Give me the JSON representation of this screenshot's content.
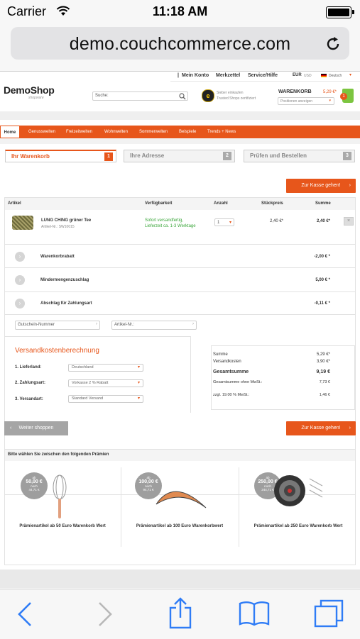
{
  "status_bar": {
    "carrier": "Carrier",
    "time": "11:18 AM"
  },
  "url_bar": {
    "url": "demo.couchcommerce.com"
  },
  "shop": {
    "top_links": [
      "Mein Konto",
      "Merkzettel",
      "Service/Hilfe"
    ],
    "currency": [
      "EUR",
      "USD"
    ],
    "language": "Deutsch",
    "logo_main": "DemoShop",
    "logo_sub": "shopware",
    "search_placeholder": "Suche:",
    "trusted_line1": "Sieber einkaufen",
    "trusted_line2": "Trusted Shops zertifiziert",
    "cart_label": "WARENKORB",
    "cart_amount": "5,29 €*",
    "cart_count": "1",
    "positions_select": "Positionen anzeigen",
    "nav": [
      "Home",
      "Genusswelten",
      "Freizeitwelten",
      "Wohnwelten",
      "Sommerwelten",
      "Beispiele",
      "Trends + News"
    ],
    "steps": [
      {
        "label": "Ihr Warenkorb",
        "num": "1"
      },
      {
        "label": "Ihre Adresse",
        "num": "2"
      },
      {
        "label": "Prüfen und Bestellen",
        "num": "3"
      }
    ],
    "checkout_button": "Zur Kasse gehen!",
    "table_headers": [
      "Artikel",
      "Verfügbarkeit",
      "Anzahl",
      "Stückpreis",
      "Summe"
    ],
    "item": {
      "name": "LUNG CHING grüner Tee",
      "number": "Artikel-Nr.: SW10015",
      "availability_line1": "Sofort versandfertig,",
      "availability_line2": "Lieferzeit ca. 1-3 Werktage",
      "quantity": "1",
      "unit_price": "2,40 €*",
      "total": "2,40 €*"
    },
    "discount_rows": [
      {
        "label": "Warenkorbrabatt",
        "value": "-2,00 € *"
      },
      {
        "label": "Mindermengenzuschlag",
        "value": "5,00 € *"
      },
      {
        "label": "Abschlag für Zahlungsart",
        "value": "-0,11 € *"
      }
    ],
    "voucher_placeholder": "Gutschein-Nummer",
    "article_placeholder": "Artikel-Nr.:",
    "shipping": {
      "title": "Versandkostenberechnung",
      "rows": [
        {
          "label": "1. Lieferland:",
          "value": "Deutschland"
        },
        {
          "label": "2. Zahlungsart:",
          "value": "Vorkasse 2 % Rabatt"
        },
        {
          "label": "3. Versandart:",
          "value": "Standard Versand"
        }
      ]
    },
    "summary": [
      {
        "label": "Summe",
        "value": "5,29 €*"
      },
      {
        "label": "Versandkosten",
        "value": "3,90 €*"
      },
      {
        "label": "Gesamtsumme",
        "value": "9,19 €"
      },
      {
        "label": "Gesamtsumme ohne MwSt.:",
        "value": "7,73 €"
      },
      {
        "label": "zzgl. 19.00 % MwSt.:",
        "value": "1,46 €"
      }
    ],
    "continue_button": "Weiter shoppen",
    "premium_heading": "Bitte wählen Sie zwischen den folgenden Prämien",
    "premiums": [
      {
        "ab": "ab",
        "amount": "50,00 €",
        "noch": "noch",
        "remaining": "44,71 €",
        "title": "Prämienartikel ab 50 Euro Warenkorb Wert"
      },
      {
        "ab": "ab",
        "amount": "100,00 €",
        "noch": "noch",
        "remaining": "94,71 €",
        "title": "Prämienartikel ab 100 Euro Warenkorbwert"
      },
      {
        "ab": "ab",
        "amount": "250,00 €",
        "noch": "noch",
        "remaining": "244,71 €",
        "title": "Prämienartikel ab 250 Euro Warenkorb Wert"
      }
    ]
  },
  "colors": {
    "accent": "#e7561b",
    "ios_blue": "#2f7cf6",
    "in_stock_green": "#3aa63a"
  }
}
